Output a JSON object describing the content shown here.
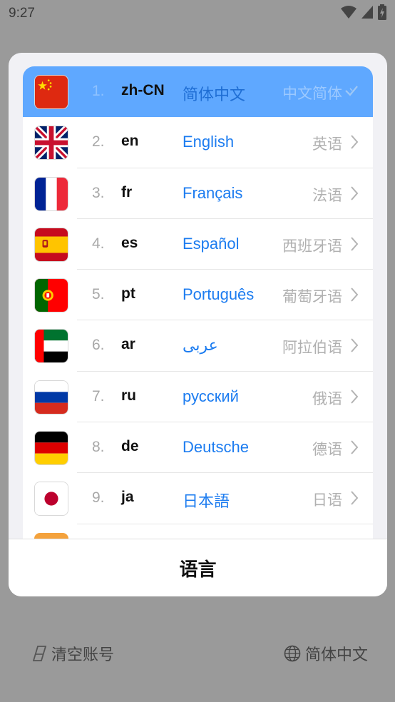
{
  "status_bar": {
    "time": "9:27"
  },
  "dialog": {
    "title": "语言",
    "languages": [
      {
        "index": "1.",
        "code": "zh-CN",
        "native": "简体中文",
        "zh": "中文简体",
        "flag": "flag-cn",
        "selected": true
      },
      {
        "index": "2.",
        "code": "en",
        "native": "English",
        "zh": "英语",
        "flag": "flag-gb"
      },
      {
        "index": "3.",
        "code": "fr",
        "native": "Français",
        "zh": "法语",
        "flag": "flag-fr"
      },
      {
        "index": "4.",
        "code": "es",
        "native": "Español",
        "zh": "西班牙语",
        "flag": "flag-es"
      },
      {
        "index": "5.",
        "code": "pt",
        "native": "Português",
        "zh": "葡萄牙语",
        "flag": "flag-pt"
      },
      {
        "index": "6.",
        "code": "ar",
        "native": "عربى",
        "zh": "阿拉伯语",
        "flag": "flag-ae"
      },
      {
        "index": "7.",
        "code": "ru",
        "native": "русский",
        "zh": "俄语",
        "flag": "flag-ru"
      },
      {
        "index": "8.",
        "code": "de",
        "native": "Deutsche",
        "zh": "德语",
        "flag": "flag-de"
      },
      {
        "index": "9.",
        "code": "ja",
        "native": "日本語",
        "zh": "日语",
        "flag": "flag-jp"
      }
    ]
  },
  "footer": {
    "clear_account": "清空账号",
    "current_language": "简体中文"
  },
  "icons": {
    "selected": "check-icon",
    "row": "chevron-right-icon"
  },
  "colors": {
    "selected_bg": "#5fa8ff",
    "native_text": "#1c7cf0"
  }
}
